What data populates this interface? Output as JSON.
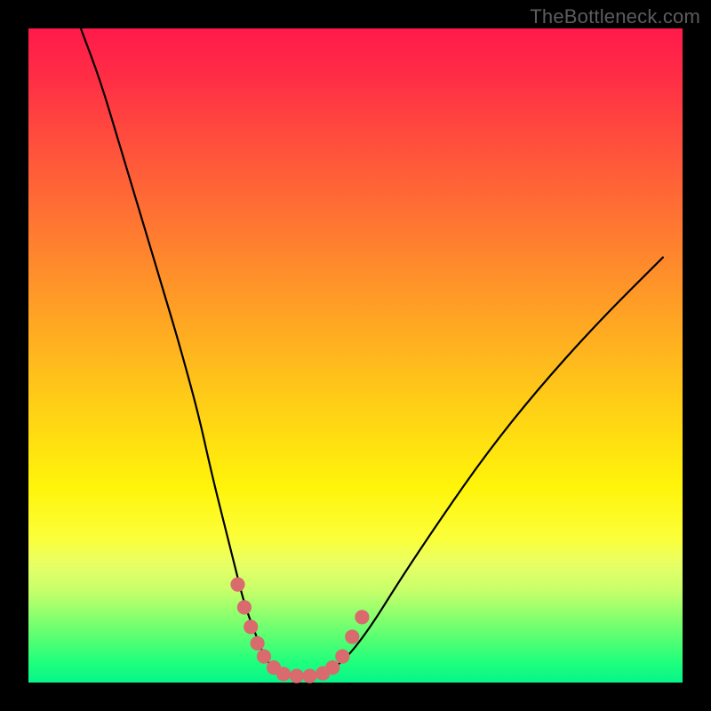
{
  "watermark": "TheBottleneck.com",
  "chart_data": {
    "type": "line",
    "title": "",
    "xlabel": "",
    "ylabel": "",
    "xlim": [
      0,
      100
    ],
    "ylim": [
      0,
      100
    ],
    "grid": false,
    "legend": false,
    "background": "rainbow-vertical-red-to-green",
    "series": [
      {
        "name": "bottleneck-curve",
        "x": [
          8,
          11,
          14,
          17,
          20,
          23,
          26,
          28,
          30,
          31.5,
          33,
          34.5,
          36,
          37.5,
          39,
          41,
          43,
          45,
          48,
          52,
          57,
          63,
          70,
          78,
          87,
          97
        ],
        "y": [
          100,
          92,
          82,
          72,
          62,
          52,
          41,
          32,
          24,
          18,
          12,
          8,
          4,
          2,
          1.2,
          1.0,
          1.0,
          1.4,
          3,
          8,
          16,
          25,
          35,
          45,
          55,
          65
        ]
      }
    ],
    "markers": {
      "name": "highlighted-points",
      "color": "#d96a6e",
      "radius_pct": 1.1,
      "points": [
        {
          "x": 32.0,
          "y": 15.0
        },
        {
          "x": 33.0,
          "y": 11.5
        },
        {
          "x": 34.0,
          "y": 8.5
        },
        {
          "x": 35.0,
          "y": 6.0
        },
        {
          "x": 36.0,
          "y": 4.0
        },
        {
          "x": 37.5,
          "y": 2.3
        },
        {
          "x": 39.0,
          "y": 1.3
        },
        {
          "x": 41.0,
          "y": 1.0
        },
        {
          "x": 43.0,
          "y": 1.0
        },
        {
          "x": 45.0,
          "y": 1.4
        },
        {
          "x": 46.5,
          "y": 2.3
        },
        {
          "x": 48.0,
          "y": 4.0
        },
        {
          "x": 49.5,
          "y": 7.0
        },
        {
          "x": 51.0,
          "y": 10.0
        }
      ]
    }
  }
}
